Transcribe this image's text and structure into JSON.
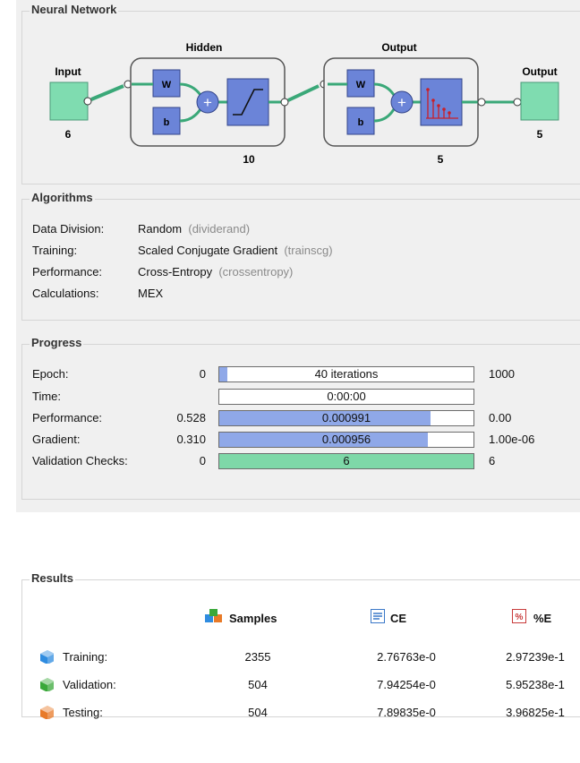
{
  "network": {
    "title": "Neural Network",
    "input_label": "Input",
    "input_size": "6",
    "hidden_label": "Hidden",
    "hidden_size": "10",
    "output_layer_label": "Output",
    "output_layer_size": "5",
    "output_label": "Output",
    "output_size": "5",
    "weight_symbol": "W",
    "bias_symbol": "b",
    "plus_symbol": "+"
  },
  "algorithms": {
    "title": "Algorithms",
    "rows": [
      {
        "label": "Data Division:",
        "value": "Random",
        "fn": "(dividerand)"
      },
      {
        "label": "Training:",
        "value": "Scaled Conjugate Gradient",
        "fn": "(trainscg)"
      },
      {
        "label": "Performance:",
        "value": "Cross-Entropy",
        "fn": "(crossentropy)"
      },
      {
        "label": "Calculations:",
        "value": "MEX",
        "fn": ""
      }
    ]
  },
  "progress": {
    "title": "Progress",
    "rows": [
      {
        "label": "Epoch:",
        "start": "0",
        "current": "40 iterations",
        "end": "1000",
        "fill": 0.03,
        "color": "#8fa8e8"
      },
      {
        "label": "Time:",
        "start": "",
        "current": "0:00:00",
        "end": "",
        "fill": 0,
        "color": "#8fa8e8"
      },
      {
        "label": "Performance:",
        "start": "0.528",
        "current": "0.000991",
        "end": "0.00",
        "fill": 0.83,
        "color": "#8fa8e8"
      },
      {
        "label": "Gradient:",
        "start": "0.310",
        "current": "0.000956",
        "end": "1.00e-06",
        "fill": 0.82,
        "color": "#8fa8e8"
      },
      {
        "label": "Validation Checks:",
        "start": "0",
        "current": "6",
        "end": "6",
        "fill": 1.0,
        "color": "#7ed8a8"
      }
    ]
  },
  "results": {
    "title": "Results",
    "headers": {
      "samples": "Samples",
      "ce": "CE",
      "pe": "%E"
    },
    "rows": [
      {
        "label": "Training:",
        "samples": "2355",
        "ce": "2.76763e-0",
        "pe": "2.97239e-1",
        "color": "#2f8ce0"
      },
      {
        "label": "Validation:",
        "samples": "504",
        "ce": "7.94254e-0",
        "pe": "5.95238e-1",
        "color": "#3aa83a"
      },
      {
        "label": "Testing:",
        "samples": "504",
        "ce": "7.89835e-0",
        "pe": "3.96825e-1",
        "color": "#e87a28"
      }
    ]
  },
  "colors": {
    "panel": "#f0f0f0",
    "node_green": "#7fdcb0",
    "block_blue": "#6b84d8",
    "bar_blue": "#8fa8e8",
    "bar_green": "#7ed8a8"
  },
  "icons": {
    "samples": "cubes-icon",
    "ce": "list-chart-icon",
    "pe": "percent-icon"
  }
}
